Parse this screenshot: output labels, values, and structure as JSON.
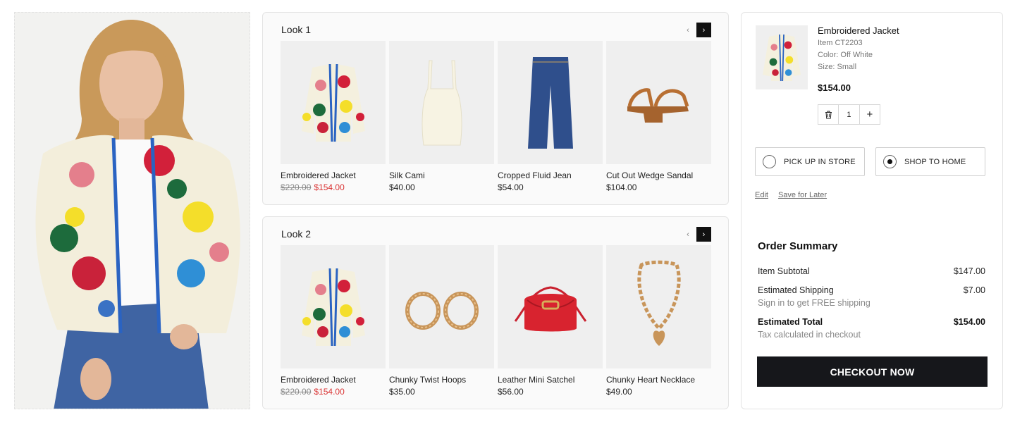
{
  "hero": {
    "image": "model-wearing-embroidered-jacket"
  },
  "looks": [
    {
      "title": "Look 1",
      "items": [
        {
          "name": "Embroidered Jacket",
          "old_price": "$220.00",
          "price": "$154.00",
          "image": "jacket"
        },
        {
          "name": "Silk Cami",
          "price": "$40.00",
          "image": "cami"
        },
        {
          "name": "Cropped Fluid Jean",
          "price": "$54.00",
          "image": "jeans"
        },
        {
          "name": "Cut Out Wedge Sandal",
          "price": "$104.00",
          "image": "sandal"
        }
      ]
    },
    {
      "title": "Look 2",
      "items": [
        {
          "name": "Embroidered Jacket",
          "old_price": "$220.00",
          "price": "$154.00",
          "image": "jacket"
        },
        {
          "name": "Chunky Twist Hoops",
          "price": "$35.00",
          "image": "hoops"
        },
        {
          "name": "Leather Mini Satchel",
          "price": "$56.00",
          "image": "satchel"
        },
        {
          "name": "Chunky Heart Necklace",
          "price": "$49.00",
          "image": "necklace"
        }
      ]
    }
  ],
  "cart": {
    "name": "Embroidered Jacket",
    "item": "Item CT2203",
    "color": "Color: Off White",
    "size": "Size: Small",
    "price": "$154.00",
    "qty": "1",
    "qty_minus_icon": "trash-icon",
    "qty_plus": "+",
    "options": [
      {
        "label": "PICK UP IN STORE",
        "selected": false
      },
      {
        "label": "SHOP TO HOME",
        "selected": true
      }
    ],
    "edit": "Edit",
    "save": "Save for Later"
  },
  "summary": {
    "title": "Order Summary",
    "subtotal_label": "Item Subtotal",
    "subtotal": "$147.00",
    "shipping_label": "Estimated Shipping",
    "shipping": "$7.00",
    "shipping_note": "Sign in to get FREE shipping",
    "total_label": "Estimated Total",
    "total": "$154.00",
    "tax_note": "Tax calculated in checkout",
    "checkout": "CHECKOUT NOW"
  },
  "nav": {
    "prev": "‹",
    "next": "›"
  },
  "colors": {
    "sale": "#d93232",
    "checkout_bg": "#16171b"
  }
}
